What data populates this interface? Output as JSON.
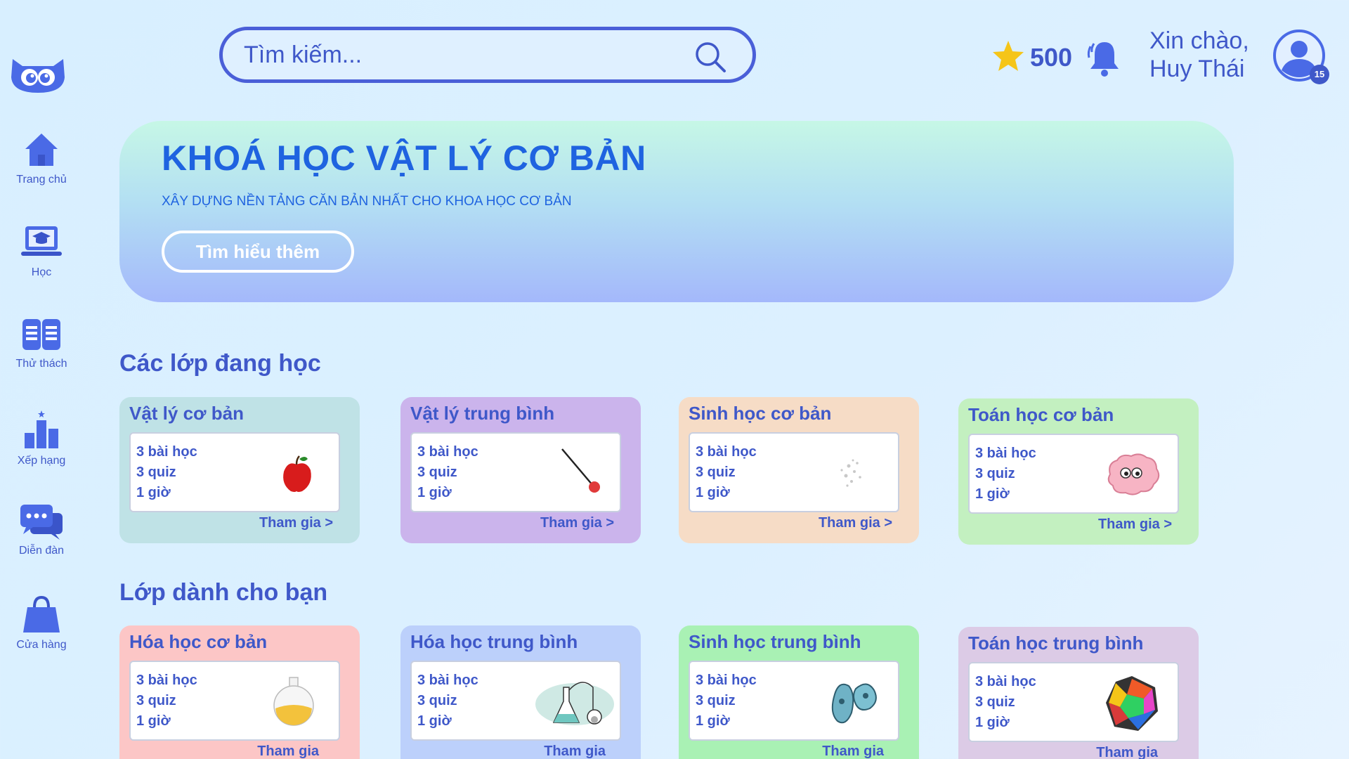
{
  "search": {
    "placeholder": "Tìm kiếm..."
  },
  "header": {
    "points": "500",
    "greeting_line1": "Xin chào,",
    "greeting_line2": "Huy Thái",
    "avatar_badge": "15"
  },
  "sidebar": {
    "items": [
      {
        "label": "Trang chủ",
        "icon": "home-icon"
      },
      {
        "label": "Học",
        "icon": "laptop-graduation-icon"
      },
      {
        "label": "Thử thách",
        "icon": "book-icon"
      },
      {
        "label": "Xếp hạng",
        "icon": "leaderboard-icon"
      },
      {
        "label": "Diễn đàn",
        "icon": "chat-icon"
      },
      {
        "label": "Cửa hàng",
        "icon": "shopping-bag-icon"
      }
    ]
  },
  "banner": {
    "title": "KHOÁ HỌC VẬT LÝ CƠ BẢN",
    "subtitle": "XÂY DỰNG NỀN TẢNG CĂN BẢN NHẤT CHO KHOA HỌC CƠ BẢN",
    "button": "Tìm hiểu thêm"
  },
  "sections": {
    "current": "Các lớp đang học",
    "suggested": "Lớp dành cho bạn"
  },
  "current_classes": [
    {
      "title": "Vật lý cơ bản",
      "lessons": "3 bài học",
      "quiz": "3 quiz",
      "time": "1 giờ",
      "join": "Tham gia >",
      "color": "#bfe2e6",
      "icon": "apple-icon"
    },
    {
      "title": "Vật lý trung bình",
      "lessons": "3 bài học",
      "quiz": "3 quiz",
      "time": "1 giờ",
      "join": "Tham gia >",
      "color": "#cbb4ec",
      "icon": "pendulum-icon"
    },
    {
      "title": "Sinh học cơ bản",
      "lessons": "3 bài học",
      "quiz": "3 quiz",
      "time": "1 giờ",
      "join": "Tham gia >",
      "color": "#f6dcc6",
      "icon": "cells-icon"
    },
    {
      "title": "Toán học cơ bản",
      "lessons": "3 bài học",
      "quiz": "3 quiz",
      "time": "1 giờ",
      "join": "Tham gia >",
      "color": "#c3f0c0",
      "icon": "brain-icon"
    }
  ],
  "suggested_classes": [
    {
      "title": "Hóa học cơ bản",
      "lessons": "3 bài học",
      "quiz": "3 quiz",
      "time": "1 giờ",
      "join": "Tham gia",
      "color": "#fcc6c6",
      "icon": "flask-icon"
    },
    {
      "title": "Hóa học trung bình",
      "lessons": "3 bài học",
      "quiz": "3 quiz",
      "time": "1 giờ",
      "join": "Tham gia",
      "color": "#bcd0fb",
      "icon": "lab-equipment-icon"
    },
    {
      "title": "Sinh học trung bình",
      "lessons": "3 bài học",
      "quiz": "3 quiz",
      "time": "1 giờ",
      "join": "Tham gia",
      "color": "#a9f1b4",
      "icon": "bacteria-icon"
    },
    {
      "title": "Toán học trung bình",
      "lessons": "3 bài học",
      "quiz": "3 quiz",
      "time": "1 giờ",
      "join": "Tham gia",
      "color": "#dccbe6",
      "icon": "polyhedron-icon"
    }
  ]
}
